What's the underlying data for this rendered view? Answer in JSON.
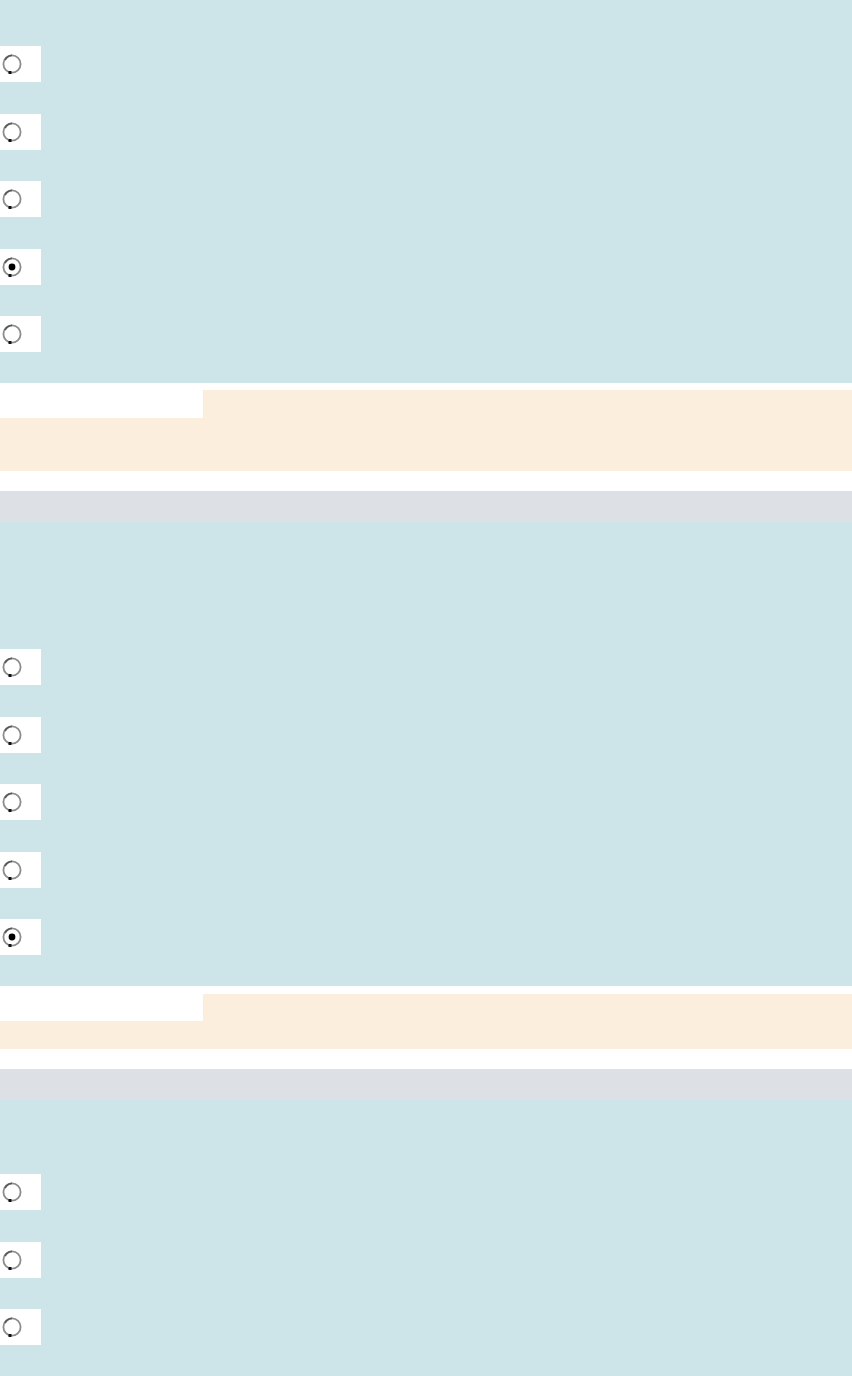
{
  "blocks": [
    {
      "kind": "options",
      "options": [
        {
          "selected": false
        },
        {
          "selected": false
        },
        {
          "selected": false
        },
        {
          "selected": true
        },
        {
          "selected": false
        }
      ]
    },
    {
      "kind": "feedback"
    },
    {
      "kind": "header"
    },
    {
      "kind": "options",
      "options": [
        {
          "selected": false
        },
        {
          "selected": false
        },
        {
          "selected": false
        },
        {
          "selected": false
        },
        {
          "selected": true
        }
      ]
    },
    {
      "kind": "feedback"
    },
    {
      "kind": "header"
    },
    {
      "kind": "options",
      "options": [
        {
          "selected": false
        },
        {
          "selected": false
        },
        {
          "selected": false
        }
      ]
    }
  ]
}
